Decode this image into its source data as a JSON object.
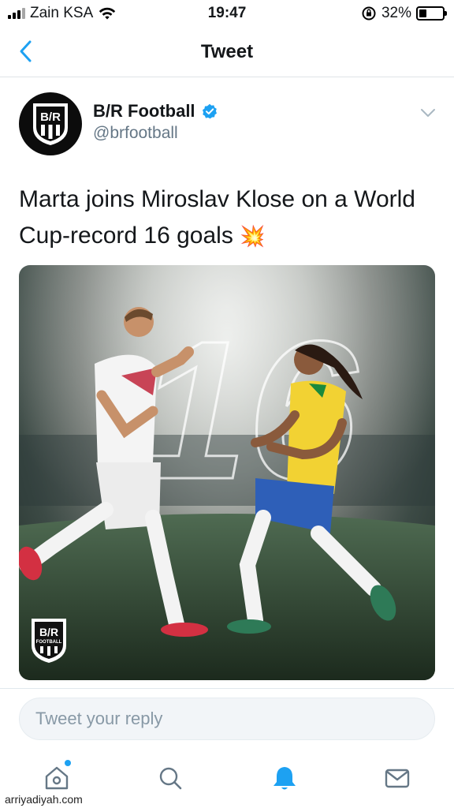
{
  "status_bar": {
    "carrier": "Zain KSA",
    "time": "19:47",
    "battery": "32%",
    "battery_level": 0.32
  },
  "nav": {
    "title": "Tweet",
    "back_icon": "chevron-left-icon"
  },
  "tweet": {
    "author_name": "B/R Football",
    "handle": "@brfootball",
    "verified": true,
    "text": "Marta joins Miroslav Klose on a World Cup-record 16 goals",
    "emoji": "💥",
    "avatar_text": "B/R",
    "media": {
      "number": "16",
      "logo_text": "B/R",
      "logo_subtext": "FOOTBALL"
    }
  },
  "reply": {
    "placeholder": "Tweet your reply"
  },
  "tab_bar": {
    "items": [
      "home-icon",
      "search-icon",
      "notifications-icon",
      "messages-icon"
    ],
    "active": "notifications-icon"
  },
  "watermark": "arriyadiyah.com",
  "colors": {
    "accent": "#1da1f2",
    "text": "#14171a",
    "muted": "#657786"
  }
}
